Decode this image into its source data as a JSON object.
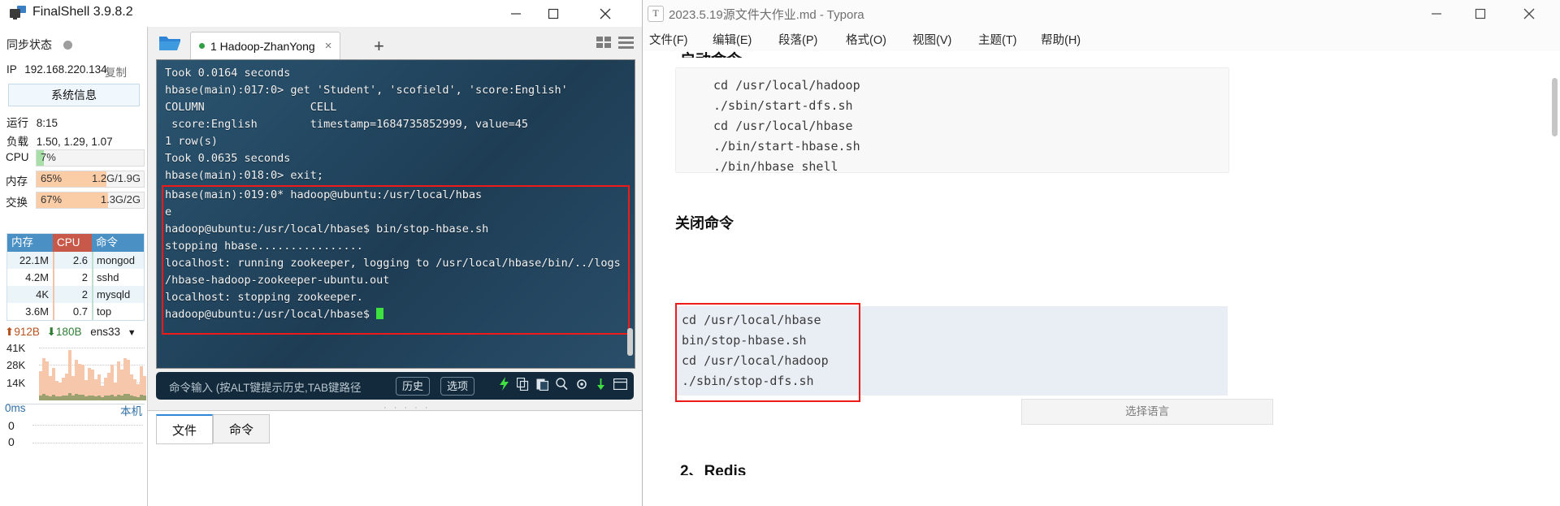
{
  "finalshell": {
    "app_title": "FinalShell 3.9.8.2",
    "window_controls": {
      "minimize": "minimize-icon",
      "maximize": "maximize-icon",
      "close": "close-icon"
    },
    "sidebar": {
      "sync_label": "同步状态",
      "ip_label": "IP",
      "ip_value": "192.168.220.134",
      "copy_label": "复制",
      "sysinfo_button": "系统信息",
      "uptime_label": "运行",
      "uptime_value": "8:15",
      "load_label": "负载",
      "load_value": "1.50, 1.29, 1.07",
      "meters": [
        {
          "name": "CPU",
          "percent": "7%",
          "right": "",
          "fill": 7,
          "color": "#a8dfa8"
        },
        {
          "name": "内存",
          "percent": "65%",
          "right": "1.2G/1.9G",
          "fill": 65,
          "color": "#fbcda6"
        },
        {
          "name": "交换",
          "percent": "67%",
          "right": "1.3G/2G",
          "fill": 67,
          "color": "#fbcda6"
        }
      ],
      "process_table": {
        "headers": [
          "内存",
          "CPU",
          "命令"
        ],
        "rows": [
          {
            "mem": "22.1M",
            "cpu": "2.6",
            "cmd": "mongod"
          },
          {
            "mem": "4.2M",
            "cpu": "2",
            "cmd": "sshd"
          },
          {
            "mem": "4K",
            "cpu": "2",
            "cmd": "mysqld"
          },
          {
            "mem": "3.6M",
            "cpu": "0.7",
            "cmd": "top"
          }
        ]
      },
      "network": {
        "up_arrow": "arrow-up-icon",
        "up_value": "912B",
        "down_arrow": "arrow-down-icon",
        "down_value": "180B",
        "interface": "ens33",
        "dropdown": "chevron-down-icon",
        "y_ticks": [
          "41K",
          "28K",
          "14K"
        ]
      },
      "ping": {
        "latency": "0ms",
        "target": "本机",
        "y_ticks": [
          "0",
          "0"
        ]
      }
    },
    "tabbar": {
      "open_folder_icon": "folder-open-icon",
      "tab_label": "1 Hadoop-ZhanYong",
      "tab_close": "close-icon",
      "new_tab": "+",
      "view_grid_icon": "grid-view-icon",
      "view_list_icon": "list-view-icon"
    },
    "terminal": {
      "lines_before": [
        "Took 0.0164 seconds",
        "hbase(main):017:0> get 'Student', 'scofield', 'score:English'",
        "COLUMN                CELL",
        " score:English        timestamp=1684735852999, value=45",
        "1 row(s)",
        "Took 0.0635 seconds",
        "hbase(main):018:0> exit;"
      ],
      "lines_highlighted": [
        "hbase(main):019:0* hadoop@ubuntu:/usr/local/hbas",
        "e",
        "hadoop@ubuntu:/usr/local/hbase$ bin/stop-hbase.sh",
        "stopping hbase................",
        "localhost: running zookeeper, logging to /usr/local/hbase/bin/../logs",
        "/hbase-hadoop-zookeeper-ubuntu.out",
        "localhost: stopping zookeeper.",
        "hadoop@ubuntu:/usr/local/hbase$ "
      ],
      "cursor": "block-cursor"
    },
    "command_bar": {
      "placeholder": "命令输入 (按ALT键提示历史,TAB键路径",
      "history_button": "历史",
      "options_button": "选项",
      "icons": [
        "lightning-icon",
        "copy-icon",
        "paste-icon",
        "search-icon",
        "gear-icon",
        "download-icon",
        "window-icon"
      ]
    },
    "bottom_tabs": [
      {
        "label": "文件",
        "active": true
      },
      {
        "label": "命令",
        "active": false
      }
    ]
  },
  "typora": {
    "app_icon": "T",
    "title": "2023.5.19源文件大作业.md - Typora",
    "window_controls": {
      "minimize": "minimize-icon",
      "maximize": "maximize-icon",
      "close": "close-icon"
    },
    "menu": [
      "文件(F)",
      "编辑(E)",
      "段落(P)",
      "格式(O)",
      "视图(V)",
      "主题(T)",
      "帮助(H)"
    ],
    "document": {
      "heading_top_cut": "启动命令",
      "code_block_1": [
        "cd /usr/local/hadoop",
        "./sbin/start-dfs.sh",
        "cd /usr/local/hbase",
        "./bin/start-hbase.sh",
        "./bin/hbase shell"
      ],
      "section_heading": "关闭命令",
      "code_block_2": [
        "cd /usr/local/hbase",
        "bin/stop-hbase.sh",
        "cd /usr/local/hadoop",
        "./sbin/stop-dfs.sh"
      ],
      "language_selector": "选择语言",
      "heading_bottom_cut": "2、Redis"
    }
  },
  "colors": {
    "highlight_box": "#ef1b1b",
    "terminal_bg": "#23445e",
    "accent_blue": "#2f86d6",
    "cursor_green": "#3ee23e"
  }
}
